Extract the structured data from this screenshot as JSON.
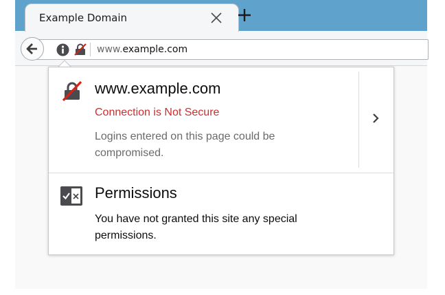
{
  "tab": {
    "title": "Example Domain"
  },
  "urlbar": {
    "prefix": "www.",
    "domain": "example.com"
  },
  "identity_panel": {
    "host": "www.example.com",
    "connection_status": "Connection is Not Secure",
    "warning": "Logins entered on this page could be compromised.",
    "permissions_title": "Permissions",
    "permissions_desc": "You have not granted this site any special permissions."
  },
  "icons": {
    "close": "close-icon",
    "new_tab": "plus-icon",
    "back": "back-arrow-icon",
    "info": "info-icon",
    "insecure_lock": "insecure-lock-icon",
    "expand": "chevron-right-icon",
    "permissions": "permissions-icon"
  },
  "colors": {
    "tabstrip": "#5fa3cd",
    "insecure_text": "#d02d2d",
    "icon_gray": "#4a4a4f"
  }
}
